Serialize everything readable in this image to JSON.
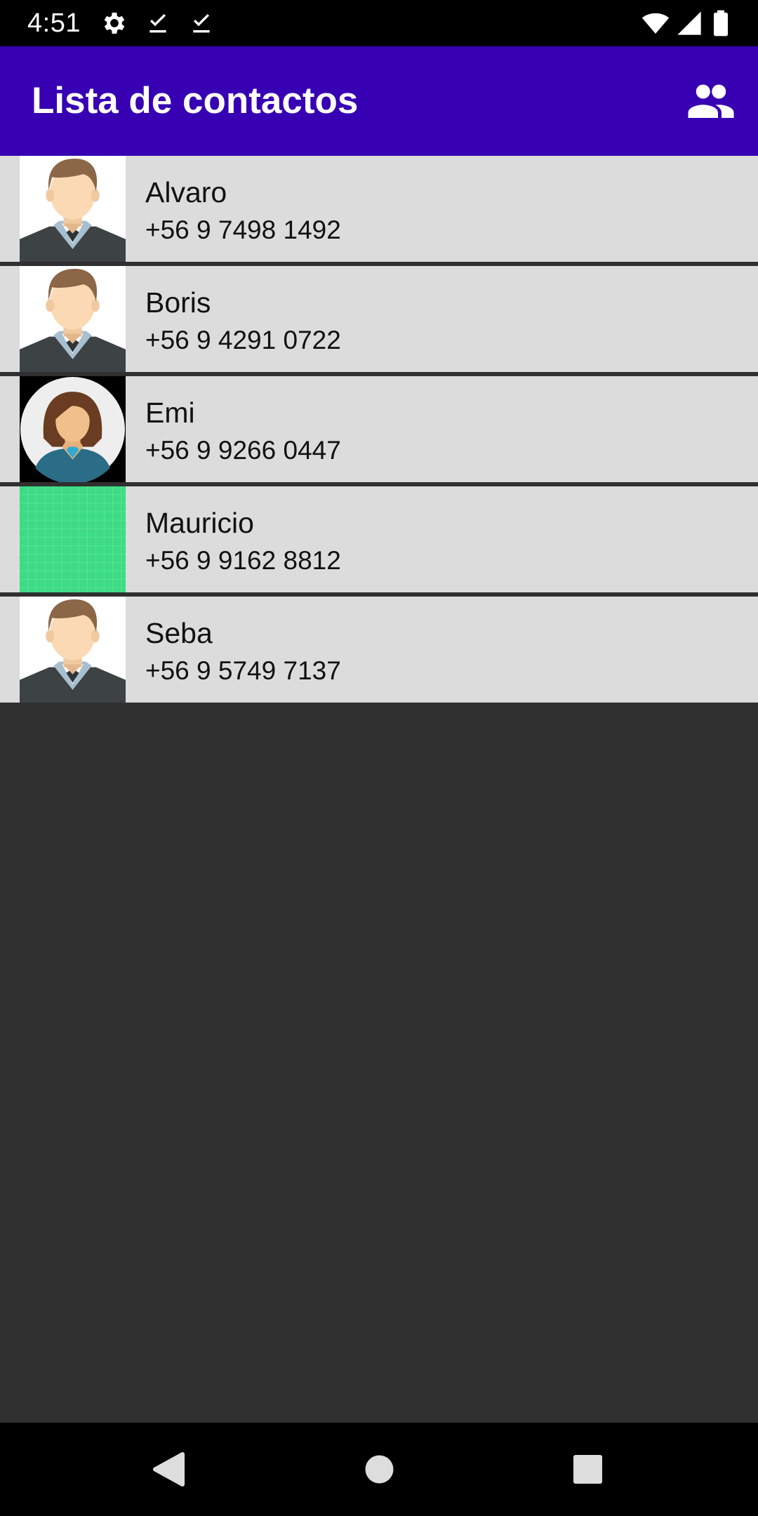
{
  "status_bar": {
    "time": "4:51",
    "left_icons": [
      "gear-icon",
      "download-done-icon",
      "download-done-icon"
    ],
    "right_icons": [
      "wifi-icon",
      "cell-signal-icon",
      "battery-icon"
    ]
  },
  "app_bar": {
    "title": "Lista de contactos",
    "action_icon": "people-icon",
    "color": "#3700b3"
  },
  "contacts": [
    {
      "name": "Alvaro",
      "phone": "+56 9 7498 1492",
      "avatar": "male-avatar-icon"
    },
    {
      "name": "Boris",
      "phone": "+56 9 4291 0722",
      "avatar": "male-avatar-icon"
    },
    {
      "name": "Emi",
      "phone": "+56 9 9266 0447",
      "avatar": "female-avatar-icon"
    },
    {
      "name": "Mauricio",
      "phone": "+56 9 9162 8812",
      "avatar": "green-placeholder-icon"
    },
    {
      "name": "Seba",
      "phone": "+56 9 5749 7137",
      "avatar": "male-avatar-icon"
    }
  ],
  "nav_bar": {
    "buttons": [
      "back-icon",
      "home-icon",
      "recents-icon"
    ]
  },
  "colors": {
    "list_background": "#dcdcdc",
    "screen_background": "#303030"
  }
}
